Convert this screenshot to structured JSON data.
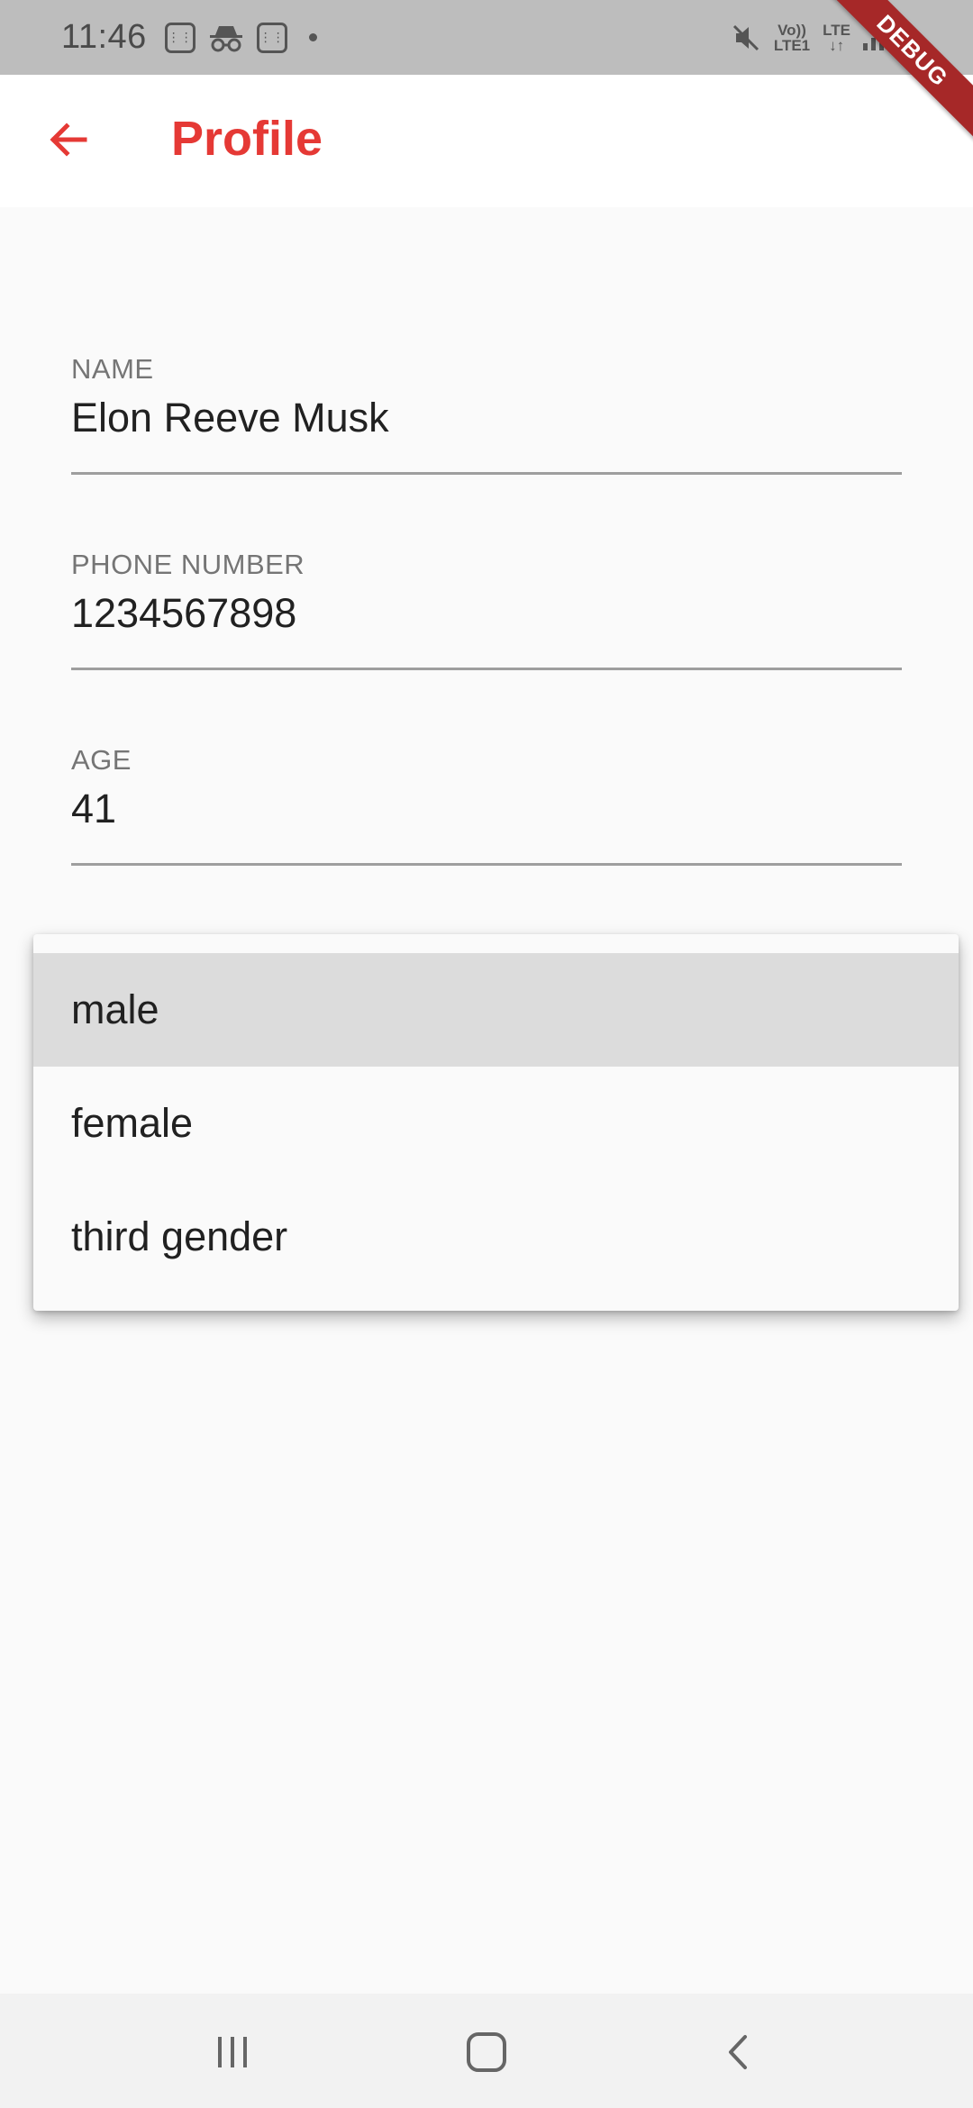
{
  "status_bar": {
    "time": "11:46",
    "net_top": "Vo))",
    "net_bottom": "LTE1",
    "lte_label": "LTE"
  },
  "debug_banner": "DEBUG",
  "app_bar": {
    "title": "Profile",
    "title_color": "#e53935",
    "back_icon": "arrow-left-icon"
  },
  "form": {
    "name": {
      "label": "NAME",
      "value": "Elon Reeve Musk"
    },
    "phone": {
      "label": "PHONE NUMBER",
      "value": "1234567898"
    },
    "age": {
      "label": "AGE",
      "value": "41"
    }
  },
  "gender_dropdown": {
    "selected": "male",
    "options": [
      "male",
      "female",
      "third gender"
    ]
  },
  "nav_bar": {
    "icons": [
      "recent-apps-icon",
      "home-icon",
      "back-icon"
    ]
  }
}
